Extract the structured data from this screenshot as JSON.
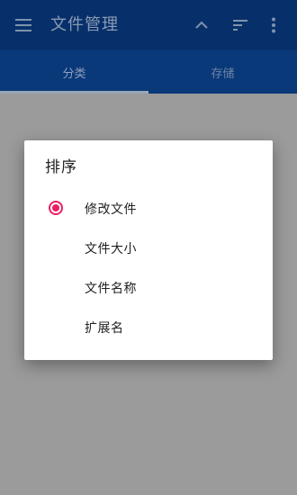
{
  "toolbar": {
    "title": "文件管理",
    "menu_icon": "hamburger-menu-icon",
    "collapse_icon": "chevron-up-icon",
    "sort_icon": "sort-icon",
    "more_icon": "more-vertical-icon"
  },
  "tabs": [
    {
      "label": "分类",
      "selected": true
    },
    {
      "label": "存储",
      "selected": false
    }
  ],
  "sort_dialog": {
    "title": "排序",
    "options": [
      {
        "label": "修改文件",
        "selected": true
      },
      {
        "label": "文件大小",
        "selected": false
      },
      {
        "label": "文件名称",
        "selected": false
      },
      {
        "label": "扩展名",
        "selected": false
      }
    ]
  },
  "colors": {
    "toolbar": "#07306b",
    "tabs": "#0a397a",
    "scrim": "#9b9b9b",
    "accent": "#e91e63"
  }
}
